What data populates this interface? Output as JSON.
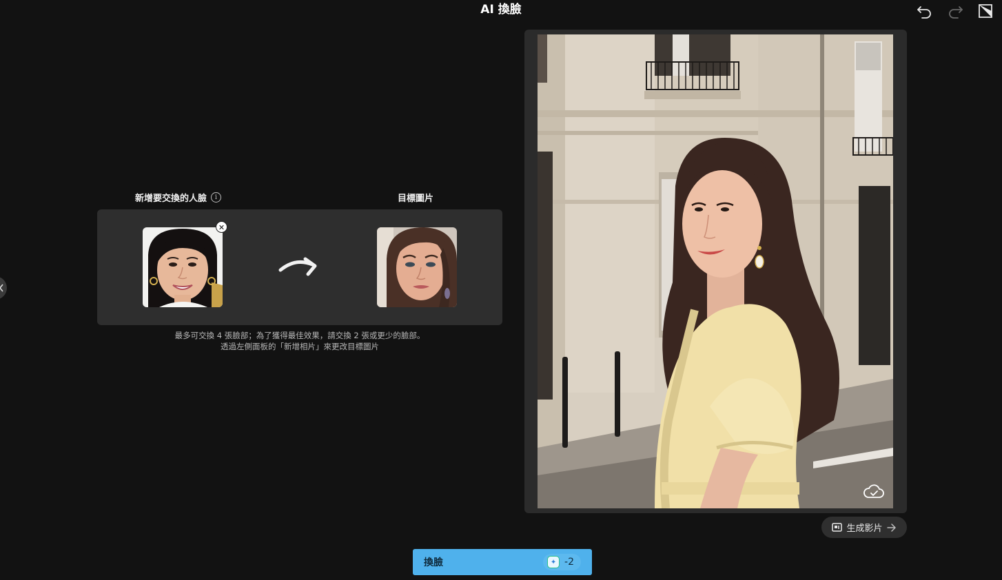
{
  "header": {
    "title": "AI 換臉"
  },
  "panel": {
    "source_label": "新增要交換的人臉",
    "target_label": "目標圖片",
    "info_icon": "info-icon",
    "remove_symbol": "✕",
    "hint_line1": "最多可交換 4 張臉部；為了獲得最佳效果，請交換 2 張或更少的臉部。",
    "hint_line2": "透過左側面板的「新增相片」來更改目標圖片"
  },
  "preview": {
    "generate_video_label": "生成影片"
  },
  "action": {
    "swap_label": "換臉",
    "credit_cost": "-2"
  },
  "icons": [
    "undo-icon",
    "redo-icon",
    "export-icon",
    "chevron-left-icon",
    "curved-arrow-icon",
    "cloud-check-icon",
    "video-icon",
    "arrow-right-icon",
    "credit-icon"
  ],
  "colors": {
    "background": "#121212",
    "panel": "#2e2e2e",
    "accent": "#4fb1ec"
  }
}
